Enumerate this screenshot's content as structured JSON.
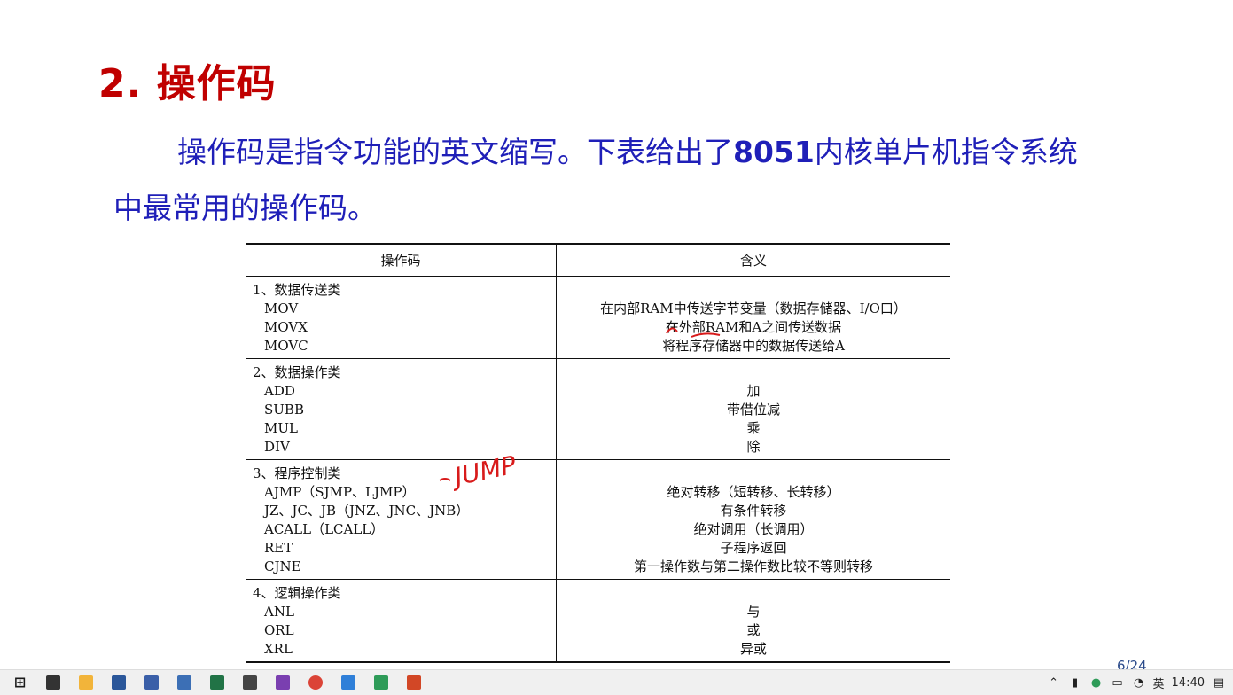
{
  "slide": {
    "title": "2. 操作码",
    "intro_line1_a": "操作码是指令功能的英文缩写。下表给出了",
    "intro_line1_bold": "8051",
    "intro_line1_b": "内核单片机指令系统",
    "intro_line2": "中最常用的操作码。",
    "handwritten_note": "JUMP",
    "page_number": "6/24"
  },
  "table": {
    "headers": [
      "操作码",
      "含义"
    ],
    "groups": [
      {
        "category": "1、数据传送类",
        "ops": [
          "MOV",
          "MOVX",
          "MOVC"
        ],
        "meanings": [
          "在内部RAM中传送字节变量（数据存储器、I/O口）",
          "在外部RAM和A之间传送数据",
          "将程序存储器中的数据传送给A"
        ]
      },
      {
        "category": "2、数据操作类",
        "ops": [
          "ADD",
          "SUBB",
          "MUL",
          "DIV"
        ],
        "meanings": [
          "加",
          "带借位减",
          "乘",
          "除"
        ]
      },
      {
        "category": "3、程序控制类",
        "ops": [
          "AJMP（SJMP、LJMP）",
          "JZ、JC、JB（JNZ、JNC、JNB）",
          "ACALL（LCALL）",
          "RET",
          "CJNE"
        ],
        "meanings": [
          "绝对转移（短转移、长转移）",
          "有条件转移",
          "绝对调用（长调用）",
          "子程序返回",
          "第一操作数与第二操作数比较不等则转移"
        ]
      },
      {
        "category": "4、逻辑操作类",
        "ops": [
          "ANL",
          "ORL",
          "XRL"
        ],
        "meanings": [
          "与",
          "或",
          "异或"
        ]
      }
    ]
  },
  "taskbar": {
    "apps": [
      {
        "name": "start-icon",
        "color": "#1a1a1a"
      },
      {
        "name": "app-swirl-icon",
        "color": "#333333"
      },
      {
        "name": "file-explorer-icon",
        "color": "#f2b43a"
      },
      {
        "name": "word-icon",
        "color": "#2b579a"
      },
      {
        "name": "app-building-icon",
        "color": "#3a5fa8"
      },
      {
        "name": "app-window-icon",
        "color": "#3c6fb5"
      },
      {
        "name": "excel-icon",
        "color": "#217346"
      },
      {
        "name": "app-pen-icon",
        "color": "#444444"
      },
      {
        "name": "app-signal-icon",
        "color": "#7a3fb0"
      },
      {
        "name": "chrome-icon",
        "color": "#db4437"
      },
      {
        "name": "app-mountain-icon",
        "color": "#2f7fd8"
      },
      {
        "name": "app-v-icon",
        "color": "#2e9b58"
      },
      {
        "name": "powerpoint-icon",
        "color": "#d24726"
      }
    ],
    "tray": {
      "ime": "英",
      "clock": "14:40"
    }
  }
}
